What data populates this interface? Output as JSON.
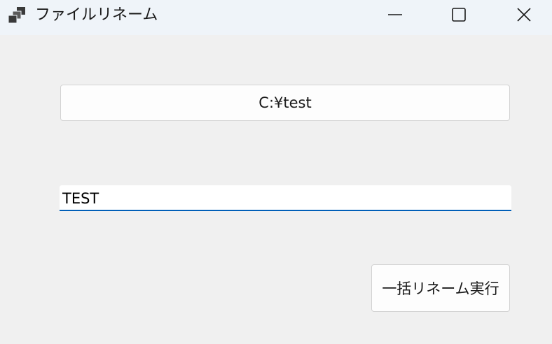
{
  "window": {
    "title": "ファイルリネーム",
    "app_icon": "app-window-icon",
    "controls": {
      "minimize_icon": "minimize-icon",
      "maximize_icon": "maximize-icon",
      "close_icon": "close-icon"
    }
  },
  "form": {
    "path_button_label": "C:¥test",
    "name_input_value": "TEST",
    "execute_button_label": "一括リネーム実行"
  },
  "colors": {
    "titlebar_bg": "#eff4f9",
    "client_bg": "#f0f0f0",
    "focus_accent": "#005fb8"
  }
}
